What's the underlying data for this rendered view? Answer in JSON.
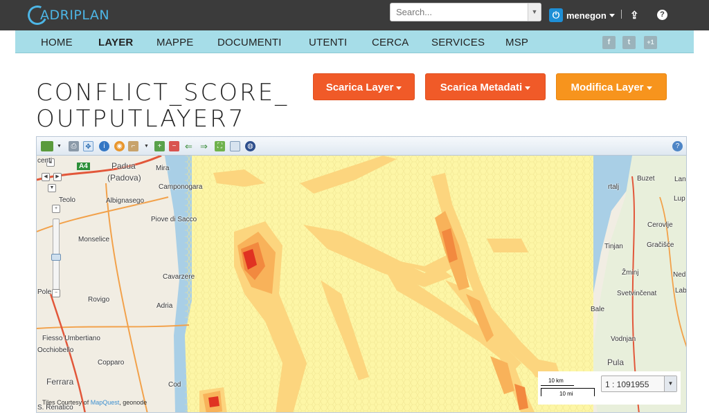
{
  "topbar": {
    "logo_text": "ADRIPLAN",
    "search": {
      "placeholder": "Search..."
    },
    "user": {
      "name": "menegon"
    },
    "icons": {
      "power": "power-icon",
      "upload": "upload-icon",
      "help": "help-icon"
    }
  },
  "nav": {
    "items": [
      {
        "label": "HOME"
      },
      {
        "label": "LAYER"
      },
      {
        "label": "MAPPE"
      },
      {
        "label": "DOCUMENTI"
      },
      {
        "label": "UTENTI"
      },
      {
        "label": "CERCA"
      },
      {
        "label": "SERVICES"
      },
      {
        "label": "MSP"
      }
    ],
    "active": "LAYER",
    "social": [
      {
        "icon": "facebook-icon",
        "glyph": "f"
      },
      {
        "icon": "twitter-icon",
        "glyph": "t"
      },
      {
        "icon": "google-plus-icon",
        "glyph": "+1"
      }
    ]
  },
  "page": {
    "title_line1": "CONFLICT_SCORE_",
    "title_line2": "OUTPUTLAYER7",
    "buttons": {
      "download_layer": "Scarica Layer",
      "download_metadata": "Scarica Metadati",
      "edit_layer": "Modifica Layer"
    }
  },
  "map": {
    "places": {
      "padua": "Padua",
      "padova": "(Padova)",
      "mira": "Mira",
      "camponogara": "Camponogara",
      "teolo": "Teolo",
      "albignasego": "Albignasego",
      "piove": "Piove di Sacco",
      "monselice": "Monselice",
      "cavarzere": "Cavarzere",
      "polesella": "Pole",
      "rovigo": "Rovigo",
      "adria": "Adria",
      "fiesso": "Fiesso Umbertiano",
      "occhiobello": "Occhiobello",
      "copparo": "Copparo",
      "ferrara": "Ferrara",
      "codigoro": "Cod",
      "renatico": "S. Renatico",
      "centi": "centi",
      "buzet": "Buzet",
      "lan": "Lan",
      "rtalj": "rtalj",
      "lupoglav": "Lup",
      "cerovlje": "Cerovlje",
      "tinjan": "Tinjan",
      "gracisce": "Gračišće",
      "zminj": "Žminj",
      "nedescina": "Ned",
      "svetvincenat": "Svetvinčenat",
      "labin": "Lab",
      "bale": "Bale",
      "vodnjan": "Vodnjan",
      "pula": "Pula",
      "motorway": "A4"
    },
    "scale": {
      "km_label": "10 km",
      "mi_label": "10 mi",
      "ratio": "1 : 1091955"
    },
    "attribution": {
      "prefix": "Tiles Courtesy of ",
      "brand": "MapQuest",
      "suffix": ", geonode"
    },
    "colors": {
      "low": "#fdf6a6",
      "mid": "#fcd57e",
      "high": "#f8b25a",
      "higher": "#f2893f",
      "highest": "#e03222",
      "water": "#a9cfe6",
      "land": "#f1ede3"
    }
  }
}
